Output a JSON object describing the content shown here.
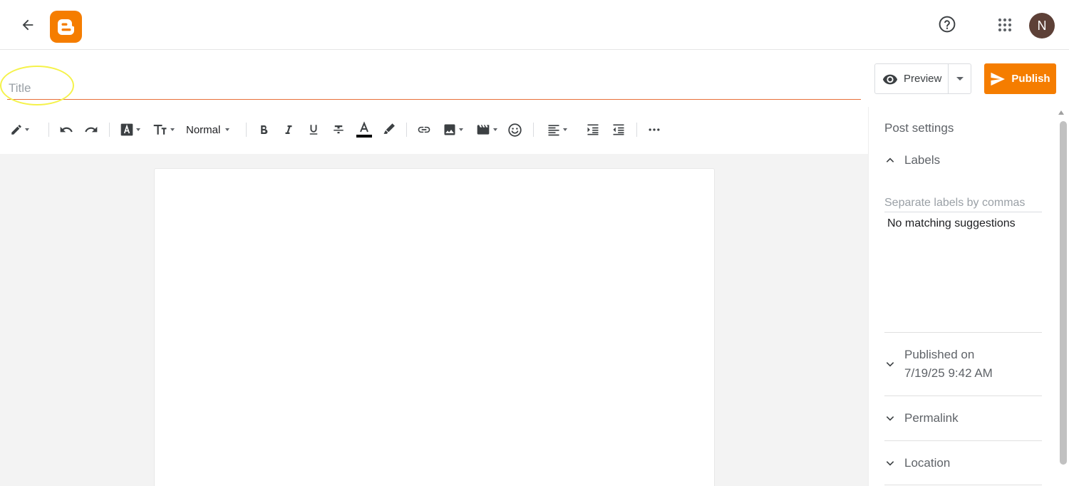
{
  "header": {
    "avatar_initial": "N"
  },
  "editor": {
    "title_placeholder": "Title",
    "title_value": ""
  },
  "actions": {
    "preview_label": "Preview",
    "publish_label": "Publish"
  },
  "toolbar": {
    "paragraph_style": "Normal"
  },
  "sidebar": {
    "title": "Post settings",
    "labels_section": "Labels",
    "labels_placeholder": "Separate labels by commas",
    "no_suggestions": "No matching suggestions",
    "published_on_label": "Published on",
    "published_on_value": "7/19/25 9:42 AM",
    "permalink_label": "Permalink",
    "location_label": "Location"
  },
  "colors": {
    "brand": "#f57d00",
    "title_underline": "#e8703a",
    "avatar": "#5d4037",
    "highlight": "#f5f24a"
  }
}
